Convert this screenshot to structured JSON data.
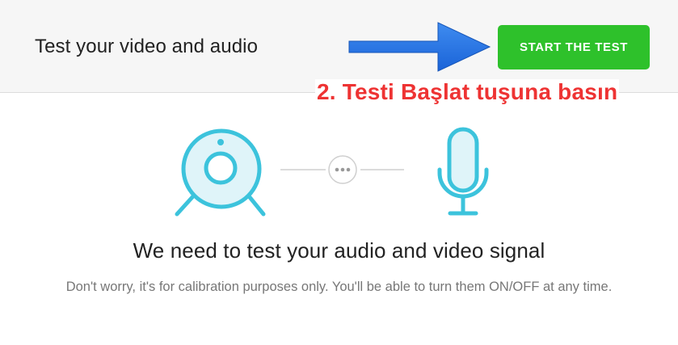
{
  "header": {
    "title": "Test your video and audio",
    "start_button_label": "START THE TEST"
  },
  "annotation": {
    "text": "2. Testi Başlat tuşuna basın",
    "arrow_color": "#1a6fe0",
    "text_color": "#ee3333"
  },
  "illustration": {
    "left_icon": "webcam-icon",
    "connector_icon": "more-horizontal-icon",
    "right_icon": "microphone-icon",
    "icon_color": "#3cc3dc"
  },
  "main": {
    "heading": "We need to test your audio and video signal",
    "subtext": "Don't worry, it's for calibration purposes only. You'll be able to turn them ON/OFF at any time."
  },
  "colors": {
    "accent_green": "#2ec12b",
    "header_bg": "#f6f6f6"
  }
}
